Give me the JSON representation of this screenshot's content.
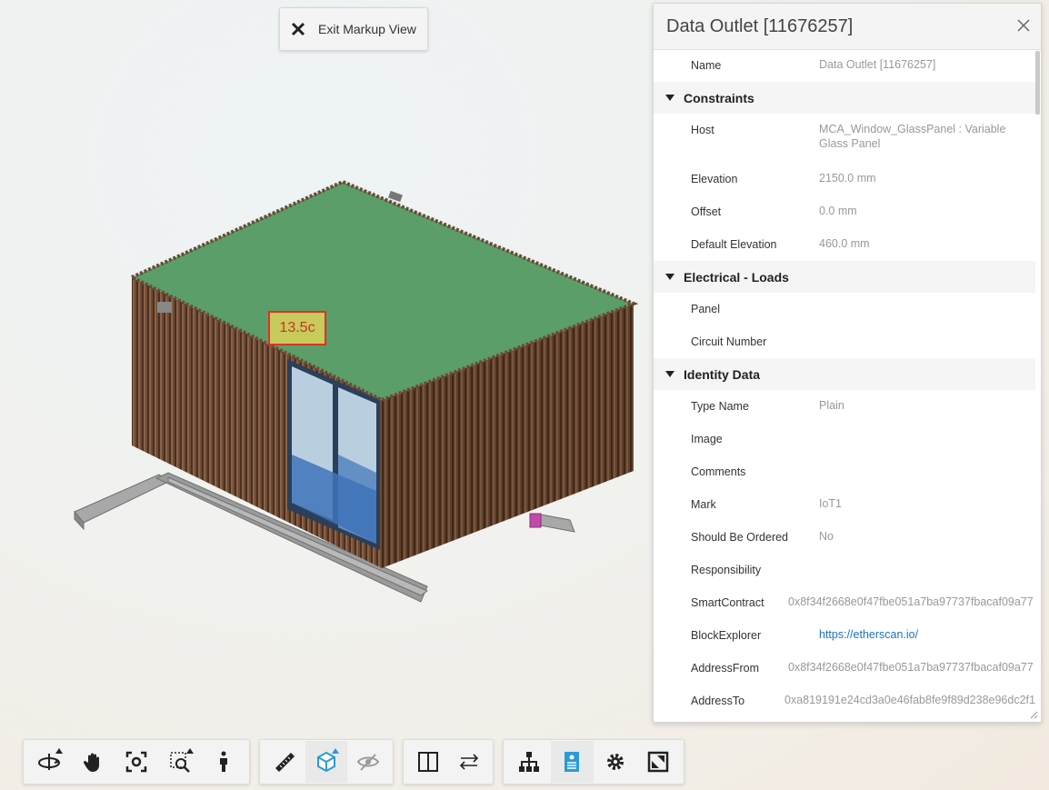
{
  "markup": {
    "exit_label": "Exit Markup View",
    "annotation_text": "13.5c"
  },
  "panel": {
    "title": "Data Outlet [11676257]",
    "name_row": {
      "key": "Name",
      "value": "Data Outlet [11676257]"
    },
    "sections": [
      {
        "title": "Constraints",
        "rows": [
          {
            "key": "Host",
            "value": "MCA_Window_GlassPanel : Variable Glass Panel"
          },
          {
            "key": "Elevation",
            "value": "2150.0 mm"
          },
          {
            "key": "Offset",
            "value": "0.0 mm"
          },
          {
            "key": "Default Elevation",
            "value": "460.0 mm"
          }
        ]
      },
      {
        "title": "Electrical - Loads",
        "rows": [
          {
            "key": "Panel",
            "value": ""
          },
          {
            "key": "Circuit Number",
            "value": ""
          }
        ]
      },
      {
        "title": "Identity Data",
        "rows": [
          {
            "key": "Type Name",
            "value": "Plain"
          },
          {
            "key": "Image",
            "value": ""
          },
          {
            "key": "Comments",
            "value": ""
          },
          {
            "key": "Mark",
            "value": "IoT1"
          },
          {
            "key": "Should Be Ordered",
            "value": "No"
          },
          {
            "key": "Responsibility",
            "value": ""
          },
          {
            "key": "SmartContract",
            "value": "0x8f34f2668e0f47fbe051a7ba97737fbacaf09a77"
          },
          {
            "key": "BlockExplorer",
            "value": "https://etherscan.io/"
          },
          {
            "key": "AddressFrom",
            "value": "0x8f34f2668e0f47fbe051a7ba97737fbacaf09a77"
          },
          {
            "key": "AddressTo",
            "value": "0xa819191e24cd3a0e46fab8fe9f89d238e96dc2f1"
          }
        ]
      }
    ]
  },
  "toolbar": {
    "groups": [
      [
        "orbit-icon",
        "pan-icon",
        "fit-to-view-icon",
        "zoom-window-icon",
        "first-person-icon"
      ],
      [
        "measure-icon",
        "section-box-icon",
        "explode-visibility-icon"
      ],
      [
        "split-view-icon",
        "compare-icon"
      ],
      [
        "model-browser-icon",
        "properties-icon",
        "settings-icon",
        "fullscreen-icon"
      ]
    ],
    "active": [
      "section-box-icon",
      "properties-icon"
    ],
    "accent_color": "#2a9bd8"
  },
  "colors": {
    "markup_border": "#e0302a",
    "roof": "#5b9e69",
    "cladding": "#6b4a35",
    "link": "#1a73c8"
  }
}
